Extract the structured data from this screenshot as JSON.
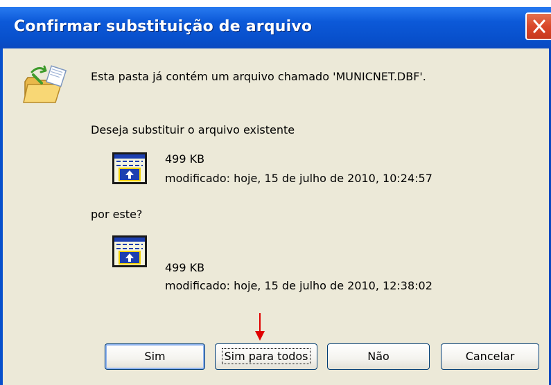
{
  "dialog": {
    "title": "Confirmar substituição de arquivo"
  },
  "message": {
    "exists": "Esta pasta já contém um arquivo chamado 'MUNICNET.DBF'.",
    "question": "Deseja substituir o arquivo existente",
    "by_this": "por este?"
  },
  "existing_file": {
    "size": "499 KB",
    "modified": "modificado: hoje, 15 de julho de 2010, 10:24:57",
    "icon": "dbf-file-icon"
  },
  "new_file": {
    "size": "499 KB",
    "modified": "modificado: hoje, 15 de julho de 2010, 12:38:02",
    "icon": "dbf-file-icon"
  },
  "buttons": {
    "yes": "Sim",
    "yes_all": "Sim para todos",
    "no": "Não",
    "cancel": "Cancelar"
  },
  "colors": {
    "titlebar": "#0a55d6",
    "close_button": "#d9472a",
    "dialog_bg": "#ece9d8",
    "annotation_arrow": "#e00000"
  }
}
